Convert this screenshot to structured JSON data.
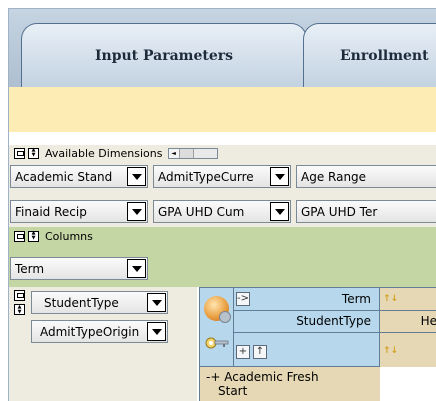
{
  "tabs": {
    "input_parameters": "Input Parameters",
    "enrollment": "Enrollment"
  },
  "available_dimensions": {
    "label": "Available Dimensions",
    "scroll_arrow": "◄",
    "row1": [
      "Academic Stand",
      "AdmitTypeCurre",
      "Age Range"
    ],
    "row2": [
      "Finaid Recip",
      "GPA UHD Cum",
      "GPA UHD Ter"
    ]
  },
  "columns": {
    "label": "Columns",
    "items": [
      "Term"
    ]
  },
  "rows": {
    "items": [
      "StudentType",
      "AdmitTypeOrigin"
    ]
  },
  "grid": {
    "column_dim_label": "Term",
    "row_dim_label": "StudentType",
    "col_value_partial": "He",
    "row_value": "Academic Fresh Start",
    "row_value_line1": "Academic Fresh",
    "row_value_line2": "Start",
    "expand_glyph": "-+",
    "collapse_glyph": "->",
    "sort_glyph": "↑",
    "plus_glyph": "+"
  },
  "colors": {
    "tab_bg": "#c3d2e1",
    "yellow_band": "#fdedb5",
    "dims_bg": "#eeece0",
    "columns_bg": "#c4d6a4",
    "grid_header_blue": "#b7d8ec",
    "grid_member_tan": "#e6d8b4"
  },
  "icons": {
    "cube_icon": "olap-cube-icon",
    "key_icon": "key-icon",
    "sort_icon": "sort-ascending-icon"
  }
}
